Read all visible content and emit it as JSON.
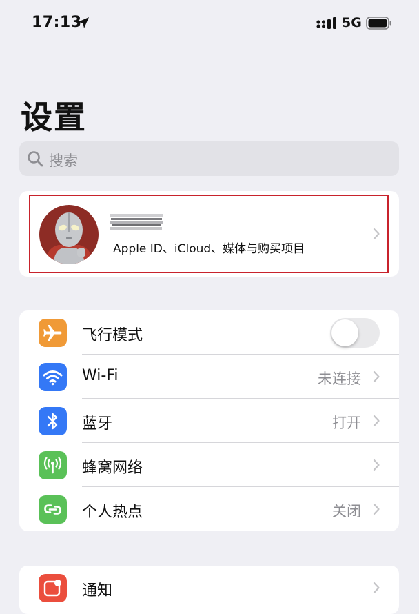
{
  "status_bar": {
    "time": "17:13",
    "network": "5G"
  },
  "page_title": "设置",
  "search": {
    "placeholder": "搜索"
  },
  "profile": {
    "subtitle": "Apple ID、iCloud、媒体与购买项目"
  },
  "connectivity": [
    {
      "label": "飞行模式",
      "value": "",
      "icon": "airplane-icon",
      "color": "#f09a37",
      "toggle": false
    },
    {
      "label": "Wi-Fi",
      "value": "未连接",
      "icon": "wifi-icon",
      "color": "#3478f6"
    },
    {
      "label": "蓝牙",
      "value": "打开",
      "icon": "bluetooth-icon",
      "color": "#3478f6"
    },
    {
      "label": "蜂窝网络",
      "value": "",
      "icon": "cellular-antenna-icon",
      "color": "#5ac158"
    },
    {
      "label": "个人热点",
      "value": "关闭",
      "icon": "hotspot-link-icon",
      "color": "#5ac158"
    }
  ],
  "notifications": {
    "label": "通知",
    "icon": "notification-bell-icon",
    "color": "#eb4e3d"
  }
}
